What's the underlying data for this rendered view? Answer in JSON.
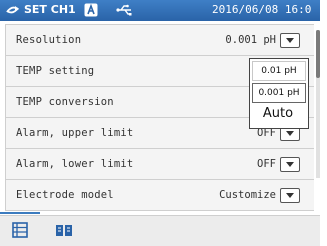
{
  "header": {
    "title": "SET CH1",
    "datetime": "2016/06/08 16:0"
  },
  "settings": [
    {
      "label": "Resolution",
      "value": "0.001 pH"
    },
    {
      "label": "TEMP setting",
      "value": ""
    },
    {
      "label": "TEMP conversion",
      "value": ""
    },
    {
      "label": "Alarm, upper limit",
      "value": "OFF"
    },
    {
      "label": "Alarm, lower limit",
      "value": "OFF"
    },
    {
      "label": "Electrode model",
      "value": "Customize"
    }
  ],
  "dropdown_options": [
    "0.01 pH",
    "0.001 pH",
    "Auto"
  ],
  "colors": {
    "header": "#2a63a8",
    "accent": "#3b7bbf"
  }
}
